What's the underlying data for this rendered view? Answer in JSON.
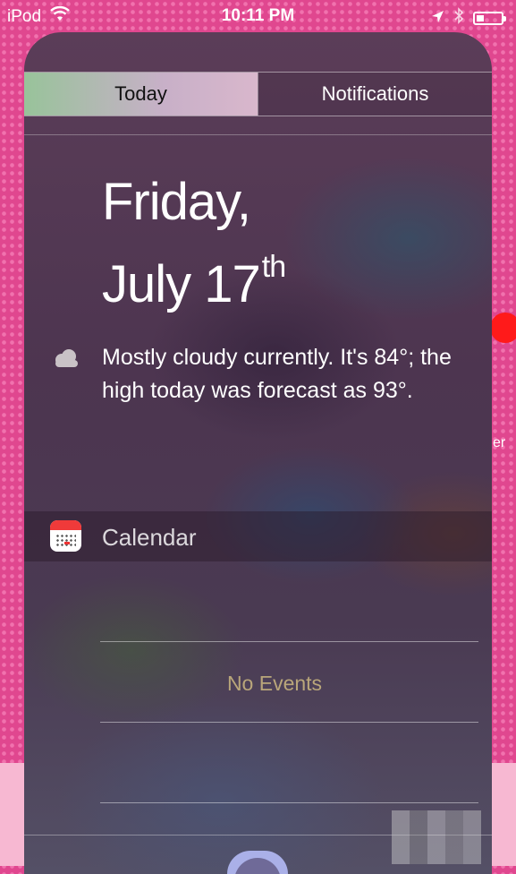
{
  "status_bar": {
    "carrier": "iPod",
    "time": "10:11 PM",
    "battery_level": 0.25
  },
  "tabs": [
    {
      "label": "Today",
      "selected": true
    },
    {
      "label": "Notifications",
      "selected": false
    }
  ],
  "today": {
    "date_line1": "Friday,",
    "date_line2": "July 17",
    "date_suffix": "th"
  },
  "weather": {
    "icon": "cloud-icon",
    "summary": "Mostly cloudy currently. It's 84°; the high today was forecast as 93°."
  },
  "calendar": {
    "title": "Calendar",
    "icon": "calendar-icon",
    "empty_text": "No Events"
  },
  "background": {
    "side_text": "er"
  },
  "colors": {
    "background_pink": "#e0478f",
    "today_tab_start": "#98c39a",
    "badge_red": "#ff1a1a",
    "no_events_text": "#b9a67a"
  }
}
